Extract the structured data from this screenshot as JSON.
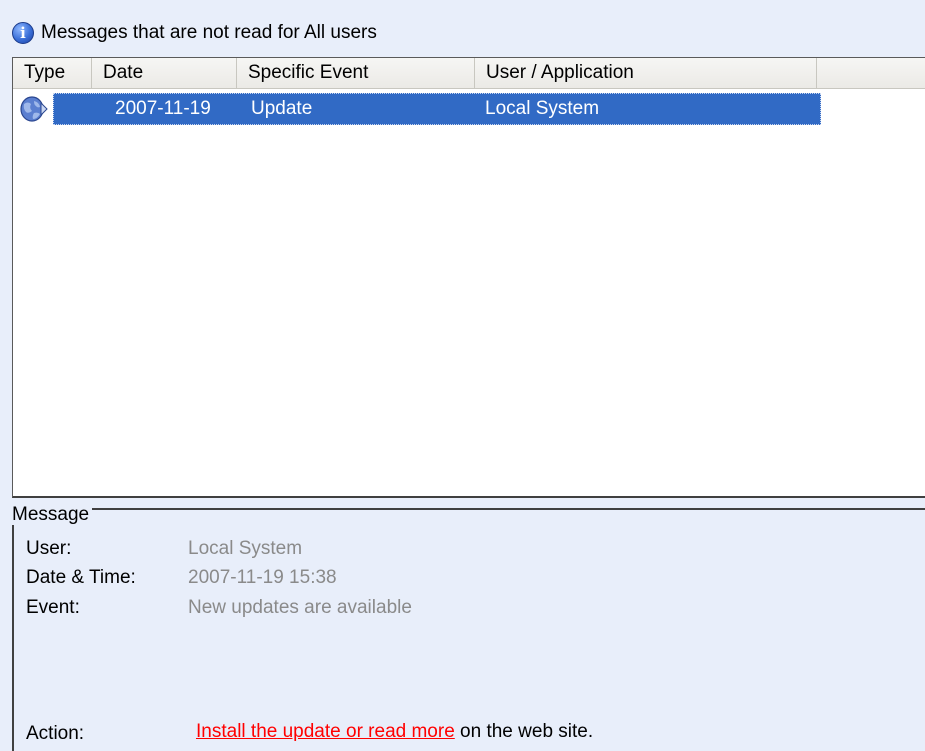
{
  "header": {
    "icon": "info-icon",
    "title": "Messages that are not read for All users"
  },
  "list": {
    "columns": [
      "Type",
      "Date",
      "Specific Event",
      "User / Application"
    ],
    "rows": [
      {
        "type_icon": "update-globe-icon",
        "date": "2007-11-19",
        "event": "Update",
        "user": "Local System",
        "selected": true
      }
    ],
    "selection_color": "#316ac5"
  },
  "message": {
    "legend": "Message",
    "user_label": "User:",
    "user_value": "Local System",
    "datetime_label": "Date & Time:",
    "datetime_value": "2007-11-19 15:38",
    "event_label": "Event:",
    "event_value": "New updates are available",
    "action_label": "Action:",
    "action_link": "Install the update or read more",
    "action_suffix": "on the web site.",
    "link_color": "#ff0000"
  }
}
